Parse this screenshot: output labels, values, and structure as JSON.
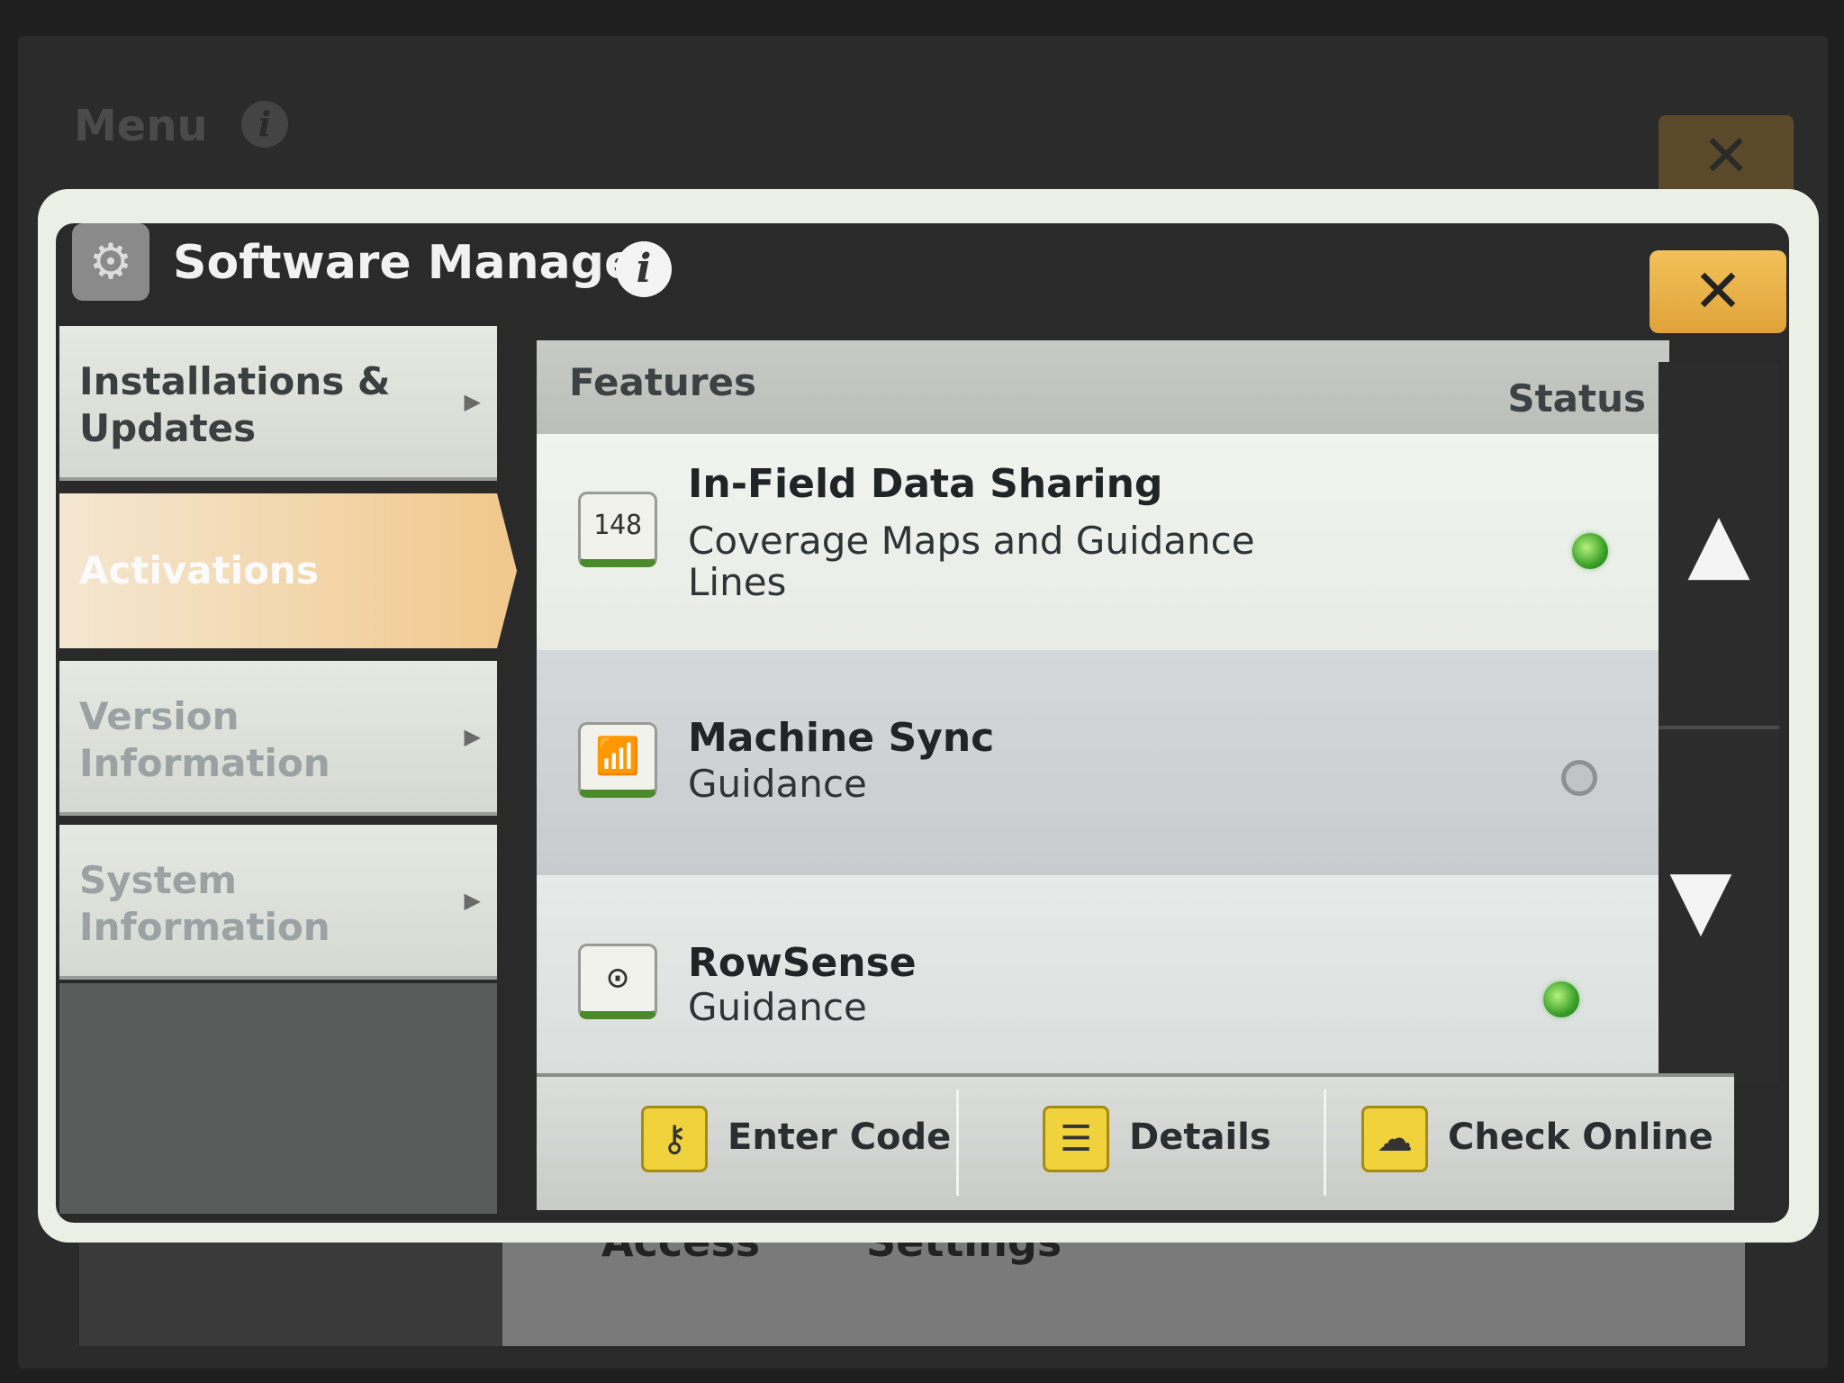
{
  "background_menu": {
    "title": "Menu",
    "info_glyph": "i",
    "close_glyph": "✕",
    "under_labels": [
      "Access",
      "Settings"
    ]
  },
  "dialog": {
    "title": "Software Manager",
    "icon": "software-manager-icon",
    "info_glyph": "i",
    "close_glyph": "✕"
  },
  "sidebar": {
    "items": [
      {
        "label": "Installations &\nUpdates",
        "arrow": "▶",
        "state": "normal"
      },
      {
        "label": "Activations",
        "arrow": "",
        "state": "active"
      },
      {
        "label": "Version\nInformation",
        "arrow": "▶",
        "state": "dim"
      },
      {
        "label": "System\nInformation",
        "arrow": "▶",
        "state": "dim"
      }
    ]
  },
  "features": {
    "header": "Features",
    "status_header": "Status",
    "rows": [
      {
        "name": "In-Field Data Sharing",
        "description": "Coverage Maps and Guidance Lines",
        "icon": "counter-display-icon",
        "icon_glyph": "148",
        "status": "active"
      },
      {
        "name": "Machine Sync",
        "description": "Guidance",
        "icon": "machine-sync-icon",
        "icon_glyph": "📶",
        "status": "inactive"
      },
      {
        "name": "RowSense",
        "description": "Guidance",
        "icon": "rowsense-icon",
        "icon_glyph": "⊙",
        "status": "active"
      }
    ]
  },
  "scroll": {
    "up_glyph": "▲",
    "down_glyph": "▼"
  },
  "toolbar": {
    "enter_code": "Enter Code",
    "enter_code_icon": "key-icon",
    "details": "Details",
    "details_icon": "document-icon",
    "check_online": "Check Online",
    "check_online_icon": "cloud-download-icon"
  },
  "colors": {
    "accent_orange": "#f1c98e",
    "close_yellow": "#e0a23a",
    "status_green": "#3aa02a",
    "button_yellow": "#f0d23c"
  }
}
